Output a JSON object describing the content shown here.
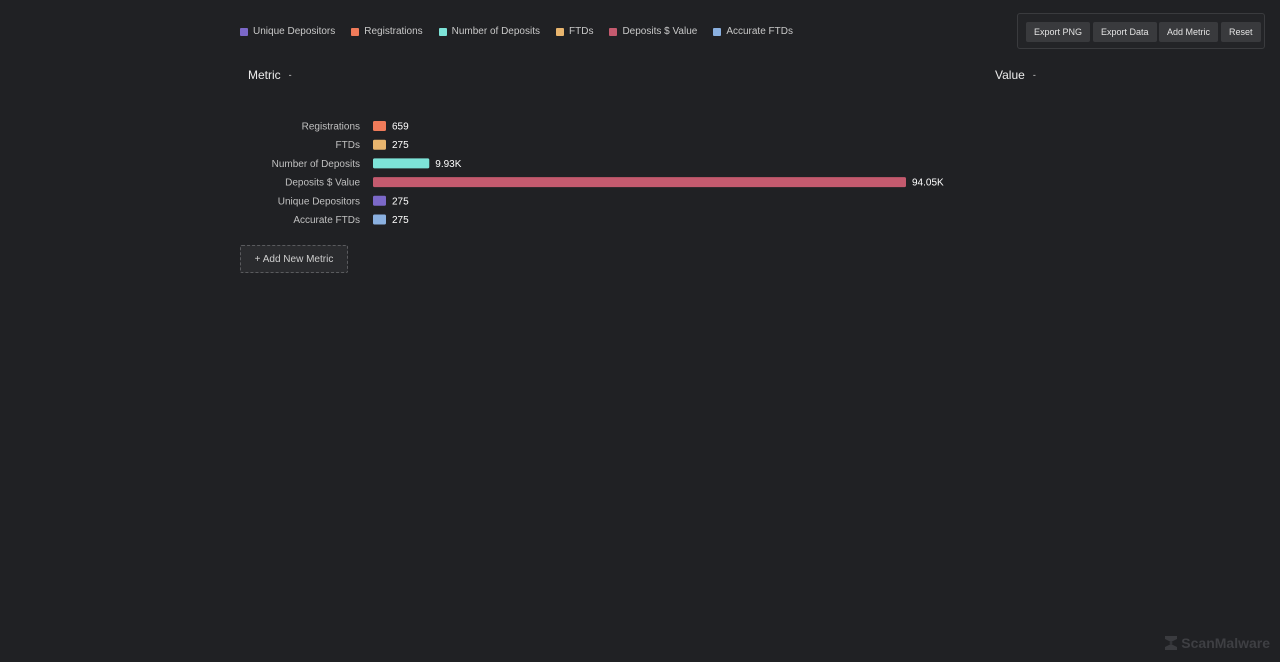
{
  "legend": [
    {
      "label": "Unique Depositors",
      "color": "#7b68c8"
    },
    {
      "label": "Registrations",
      "color": "#f07b5a"
    },
    {
      "label": "Number of Deposits",
      "color": "#7de3d8"
    },
    {
      "label": "FTDs",
      "color": "#e8b56e"
    },
    {
      "label": "Deposits $ Value",
      "color": "#c45a6e"
    },
    {
      "label": "Accurate FTDs",
      "color": "#8ab0e0"
    }
  ],
  "toolbar": {
    "export_png": "Export PNG",
    "export_data": "Export Data",
    "add_metric": "Add Metric",
    "reset": "Reset"
  },
  "headers": {
    "metric": "Metric",
    "value": "Value",
    "sort_glyph": "-"
  },
  "add_new_label": "+ Add New Metric",
  "watermark": "ScanMalware",
  "chart_data": {
    "type": "bar",
    "orientation": "horizontal",
    "categories": [
      "Registrations",
      "FTDs",
      "Number of Deposits",
      "Deposits $ Value",
      "Unique Depositors",
      "Accurate FTDs"
    ],
    "values": [
      659,
      275,
      9930,
      94050,
      275,
      275
    ],
    "value_labels": [
      "659",
      "275",
      "9.93K",
      "94.05K",
      "275",
      "275"
    ],
    "colors": [
      "#f07b5a",
      "#e8b56e",
      "#7de3d8",
      "#c45a6e",
      "#7b68c8",
      "#8ab0e0"
    ],
    "xlim": [
      0,
      94050
    ],
    "grid": false
  }
}
